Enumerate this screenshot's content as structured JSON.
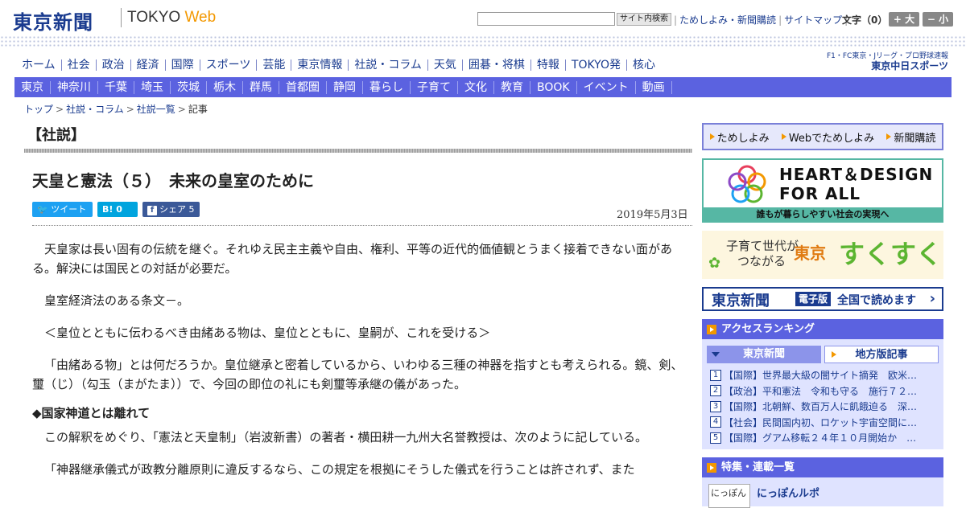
{
  "header": {
    "logo_jp": "東京新聞",
    "logo_en_a": "TOKYO ",
    "logo_en_b": "Web",
    "search_button": "サイト内検索",
    "links": [
      "ためしよみ・新聞購読",
      "サイトマップ"
    ],
    "font_label": "文字（0）",
    "font_bigger": "+ 大",
    "font_smaller": "− 小"
  },
  "nav_primary": [
    "ホーム",
    "社会",
    "政治",
    "経済",
    "国際",
    "スポーツ",
    "芸能",
    "東京情報",
    "社説・コラム",
    "天気",
    "囲碁・将棋",
    "特報",
    "TOKYO発",
    "核心"
  ],
  "chunichi": {
    "line1": "F1・FC東京・Jリーグ・プロ野球速報",
    "line2": "東京中日スポーツ"
  },
  "nav_secondary": [
    "東京",
    "神奈川",
    "千葉",
    "埼玉",
    "茨城",
    "栃木",
    "群馬",
    "首都圏",
    "静岡",
    "暮らし",
    "子育て",
    "文化",
    "教育",
    "BOOK",
    "イベント",
    "動画"
  ],
  "breadcrumb": [
    "トップ",
    "社説・コラム",
    "社説一覧",
    "記事"
  ],
  "article": {
    "section": "【社説】",
    "title": "天皇と憲法（５）　未来の皇室のために",
    "share_tweet": "ツイート",
    "share_hatena": "B! 0",
    "share_fb": "シェア 5",
    "date": "2019年5月3日",
    "p1": "天皇家は長い固有の伝統を継ぐ。それゆえ民主主義や自由、権利、平等の近代的価値観とうまく接着できない面がある。解決には国民との対話が必要だ。",
    "p2": "皇室経済法のある条文－。",
    "p3": "＜皇位とともに伝わるべき由緒ある物は、皇位とともに、皇嗣が、これを受ける＞",
    "p4": "「由緒ある物」とは何だろうか。皇位継承と密着しているから、いわゆる三種の神器を指すとも考えられる。鏡、剣、璽（じ）（勾玉（まがたま））で、今回の即位の礼にも剣璽等承継の儀があった。",
    "h1": "◆国家神道とは離れて",
    "p5": "この解釈をめぐり、「憲法と天皇制」（岩波新書）の著者・横田耕一九州大名誉教授は、次のように記している。",
    "p6": "「神器継承儀式が政教分離原則に違反するなら、この規定を根拠にそうした儀式を行うことは許されず、また"
  },
  "sidebar": {
    "tameshi": [
      "ためしよみ",
      "Webでためしよみ",
      "新聞購読"
    ],
    "hd_line1": "HEART＆DESIGN",
    "hd_line2": "FOR ALL",
    "hd_sub": "誰もが暮らしやすい社会の実現へ",
    "suku_l1": "子育て世代が",
    "suku_l2": "つながる",
    "suku_city": "東京",
    "suku_name": "すくすく",
    "denshi_name": "東京新聞",
    "denshi_tag": "電子版",
    "denshi_text": "全国で読めます",
    "ranking_title": "アクセスランキング",
    "ranking_tab1": "東京新聞",
    "ranking_tab2": "地方版記事",
    "ranking": [
      {
        "n": "1",
        "t": "【国際】世界最大級の闇サイト摘発　欧米…"
      },
      {
        "n": "2",
        "t": "【政治】平和憲法　令和も守る　施行７２…"
      },
      {
        "n": "3",
        "t": "【国際】北朝鮮、数百万人に飢餓迫る　深…"
      },
      {
        "n": "4",
        "t": "【社会】民間国内初、ロケット宇宙空間に…"
      },
      {
        "n": "5",
        "t": "【国際】グアム移転２４年１０月開始か　…"
      }
    ],
    "tokushu_title": "特集・連載一覧",
    "tokushu_thumb": "にっぽん",
    "tokushu_name": "にっぽんルポ"
  },
  "colors": {
    "brand": "#1a3b8f",
    "nav_bg": "#5b62e0",
    "accent": "#f39800"
  }
}
